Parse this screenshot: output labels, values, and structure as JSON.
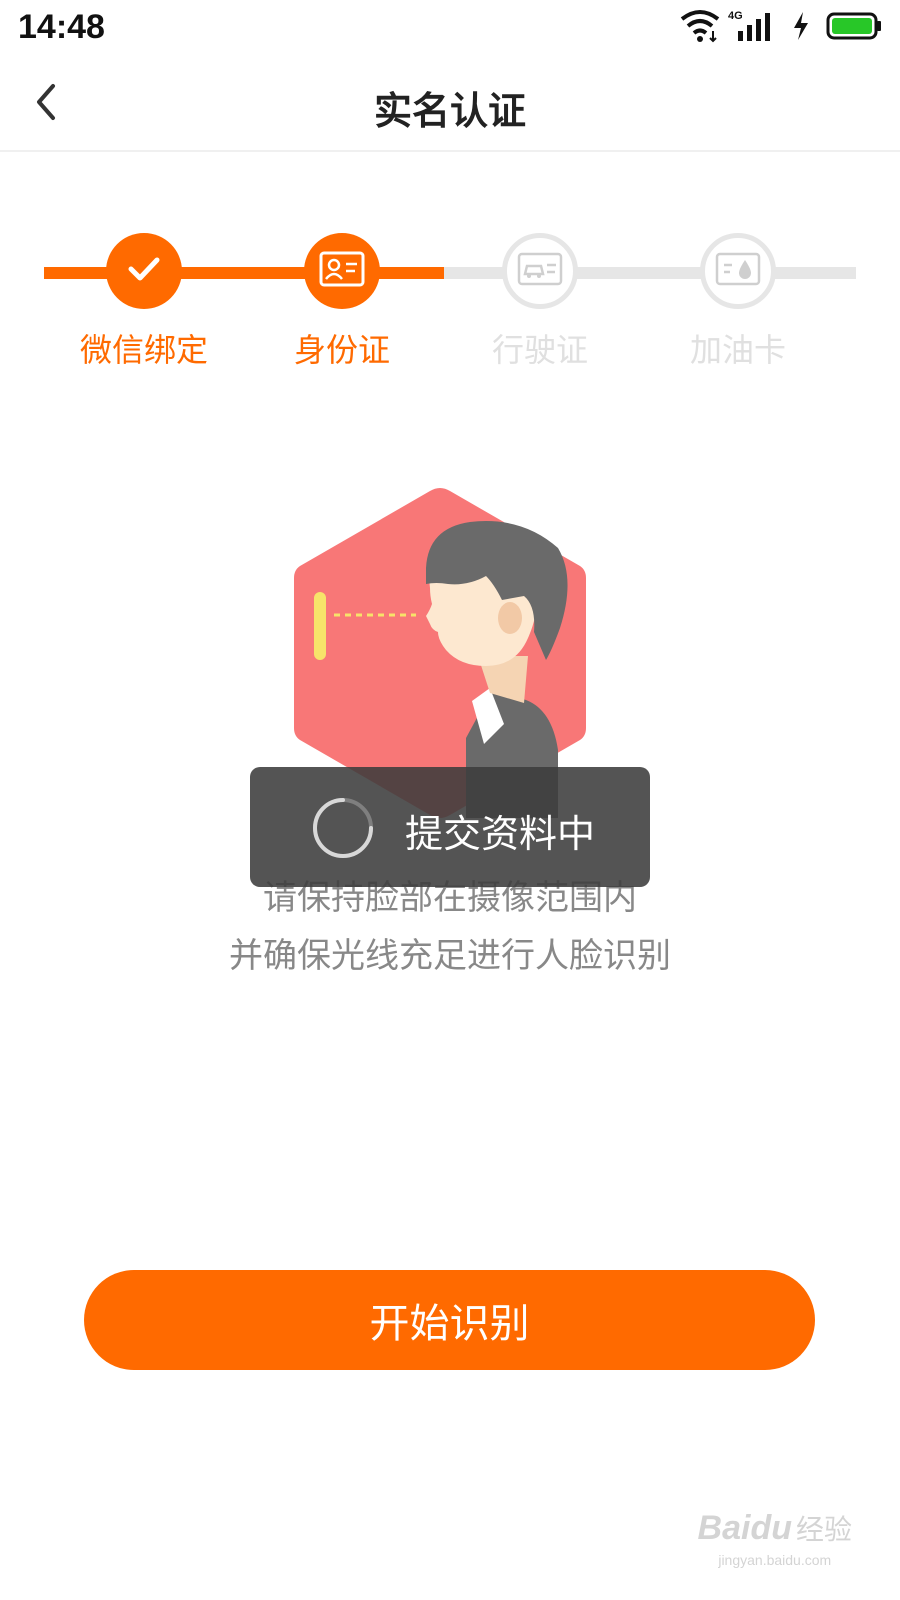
{
  "status_bar": {
    "time": "14:48",
    "network": "4G"
  },
  "header": {
    "title": "实名认证"
  },
  "steps": [
    {
      "label": "微信绑定",
      "state": "done",
      "icon": "check-icon"
    },
    {
      "label": "身份证",
      "state": "current",
      "icon": "id-card-icon"
    },
    {
      "label": "行驶证",
      "state": "pending",
      "icon": "vehicle-license-icon"
    },
    {
      "label": "加油卡",
      "state": "pending",
      "icon": "fuel-card-icon"
    }
  ],
  "instructions": {
    "line1": "请保持脸部在摄像范围内",
    "line2": "并确保光线充足进行人脸识别"
  },
  "toast": {
    "text": "提交资料中"
  },
  "start_button": {
    "label": "开始识别"
  },
  "watermark": {
    "brand": "Baidu",
    "suffix": "经验",
    "url": "jingyan.baidu.com"
  },
  "colors": {
    "accent": "#ff6a00",
    "inactive": "#e6e6e6",
    "hexagon": "#f87777"
  }
}
